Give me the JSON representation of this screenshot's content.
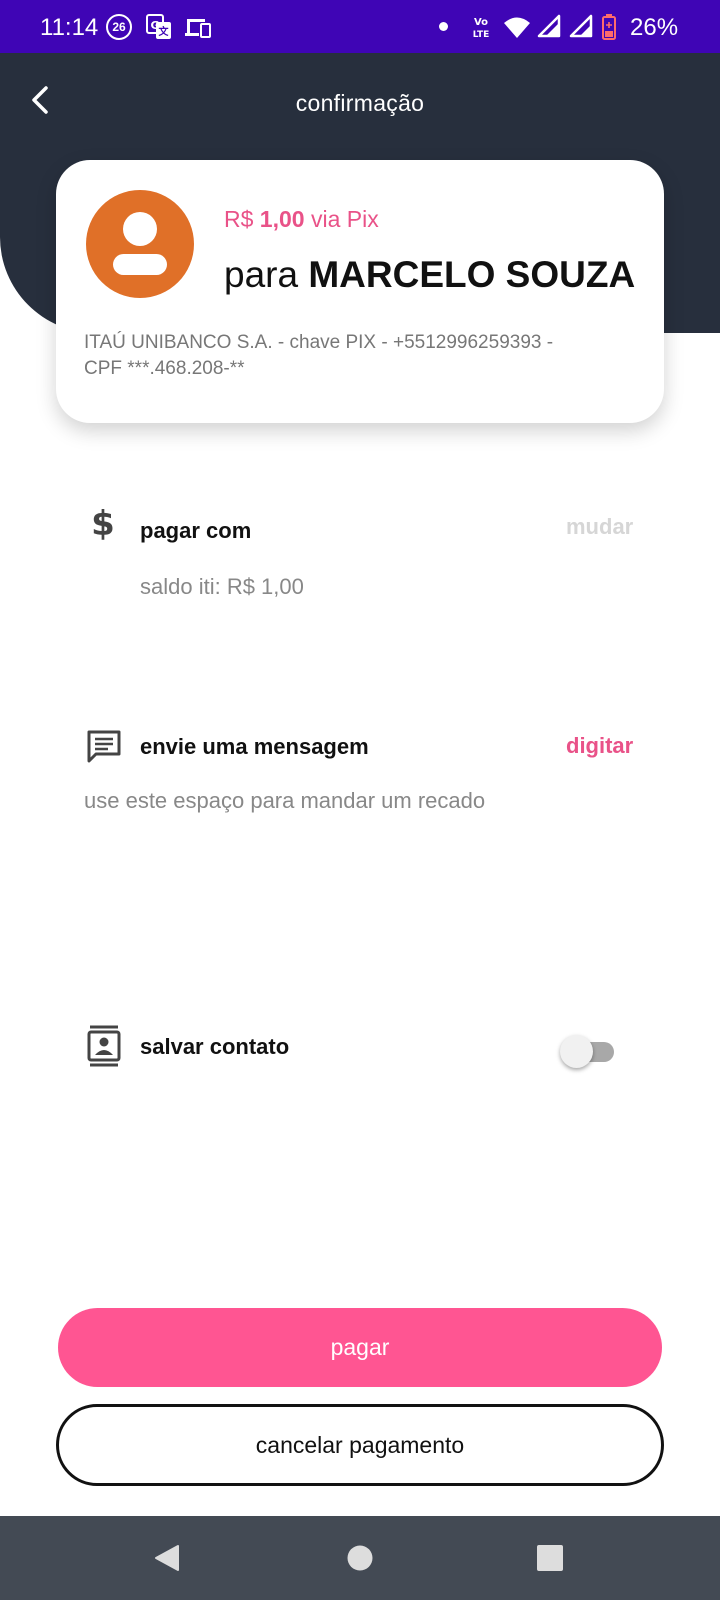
{
  "status_bar": {
    "time": "11:14",
    "badge": "26",
    "network": "Vo LTE",
    "battery": "26%",
    "icons": [
      "notification-26-icon",
      "translate-icon",
      "devices-icon",
      "dot-icon",
      "volte-icon",
      "wifi-icon",
      "signal-icon",
      "signal-icon",
      "battery-icon"
    ]
  },
  "header": {
    "title": "confirmação",
    "back_icon": "chevron-left-icon"
  },
  "card": {
    "amount_prefix": "R$ ",
    "amount_value": "1,00",
    "amount_suffix": " via Pix",
    "recipient_prefix": "para ",
    "recipient_name": "MARCELO SOUZA",
    "bank_info": "ITAÚ UNIBANCO S.A. - chave PIX - +5512996259393 - CPF ***.468.208-**"
  },
  "payment": {
    "title": "pagar com",
    "source": "saldo iti: R$ 1,00",
    "action": "mudar",
    "icon": "dollar-icon"
  },
  "message": {
    "title": "envie uma mensagem",
    "placeholder": "use este espaço para mandar um recado",
    "action": "digitar",
    "icon": "message-icon"
  },
  "contact": {
    "title": "salvar contato",
    "toggle_on": false,
    "icon": "contact-card-icon"
  },
  "buttons": {
    "pay": "pagar",
    "cancel": "cancelar pagamento"
  },
  "colors": {
    "status_bar": "#3f05b5",
    "header": "#272f3d",
    "accent_pink": "#ff5592",
    "link_pink": "#e95288",
    "avatar": "#e07028",
    "nav_bar": "#434a54"
  },
  "nav_bar": {
    "icons": [
      "back-triangle-icon",
      "home-circle-icon",
      "recents-square-icon"
    ]
  }
}
